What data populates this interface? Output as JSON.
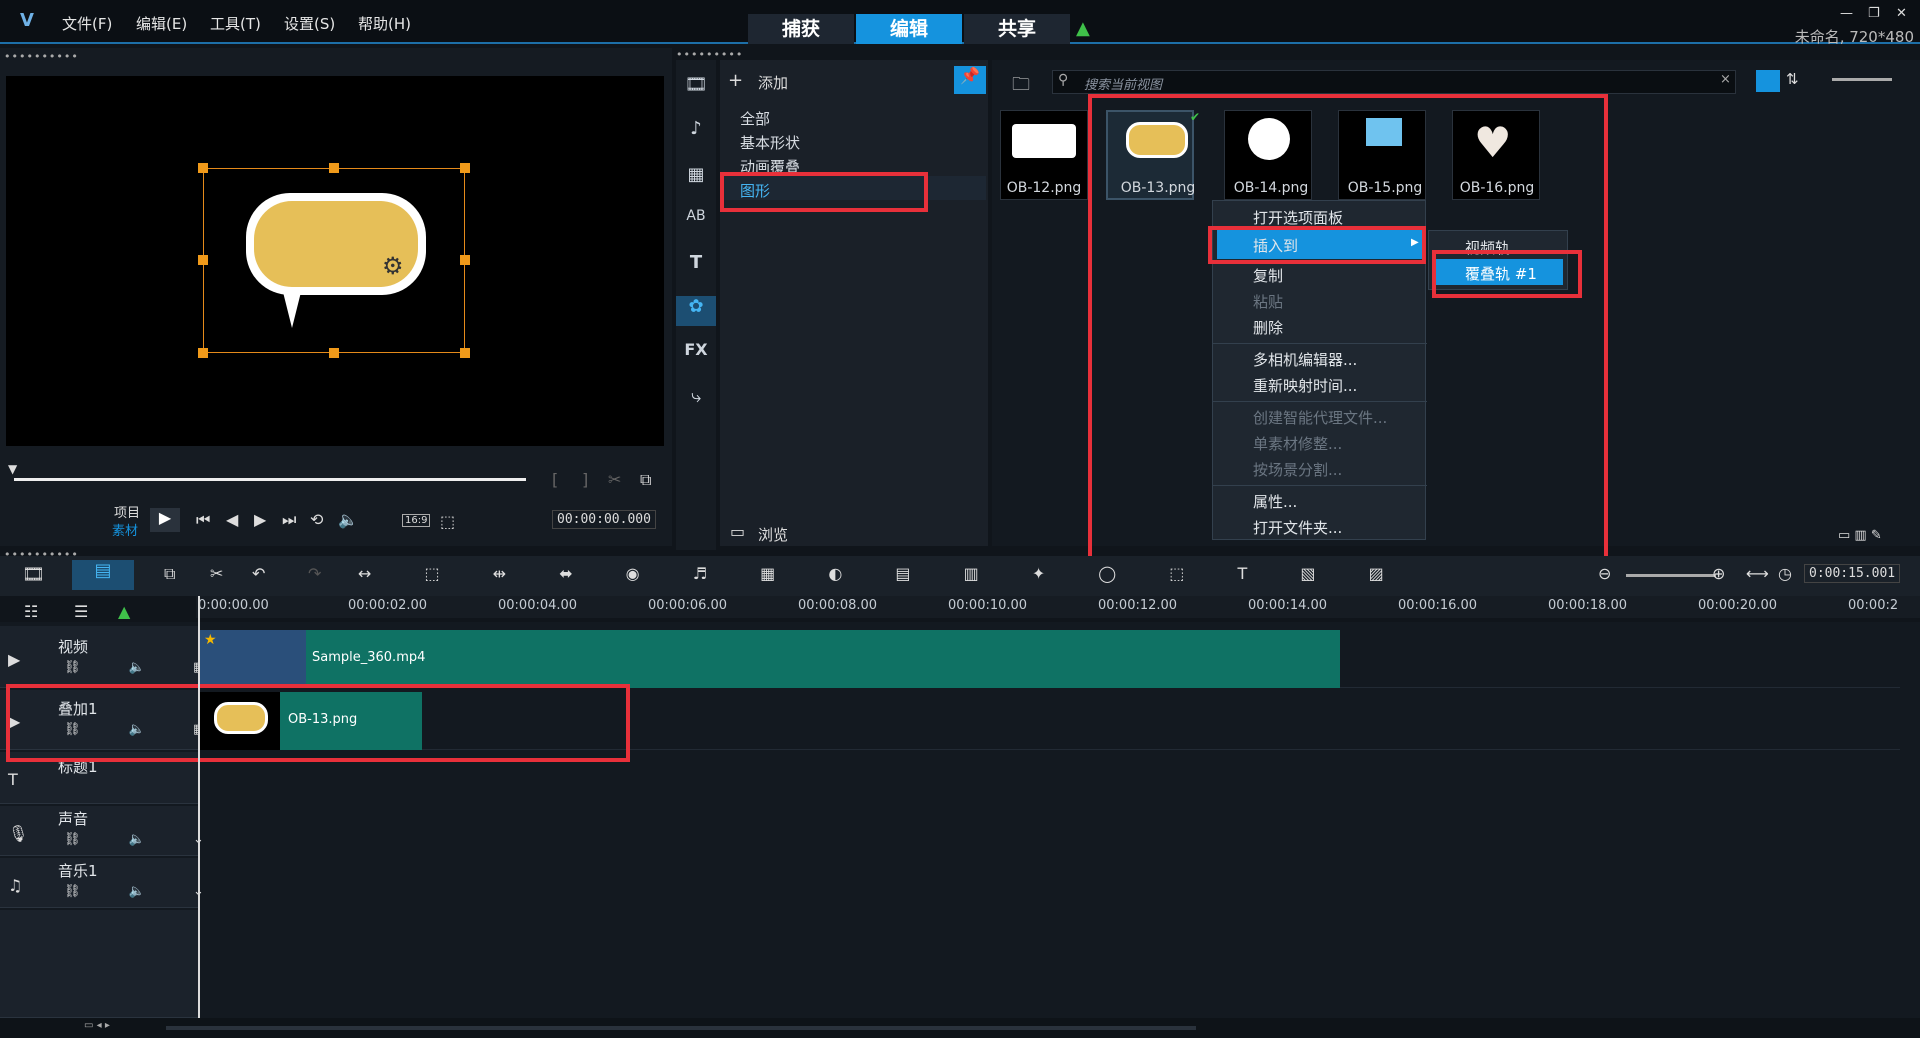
{
  "menubar": {
    "items": [
      "文件(F)",
      "编辑(E)",
      "工具(T)",
      "设置(S)",
      "帮助(H)"
    ],
    "modes": [
      "捕获",
      "编辑",
      "共享"
    ],
    "active_mode": "编辑",
    "project": "未命名, 720*480"
  },
  "preview": {
    "mode_project": "项目",
    "mode_clip": "素材",
    "aspect": "16:9",
    "timecode": "00:00:00.000"
  },
  "library": {
    "add_label": "添加",
    "categories": [
      "全部",
      "基本形状",
      "动画覆叠",
      "图形"
    ],
    "selected_category": "图形",
    "browse_label": "浏览",
    "search_placeholder": "搜索当前视图",
    "thumbs": [
      "OB-12.png",
      "OB-13.png",
      "OB-14.png",
      "OB-15.png",
      "OB-16.png"
    ]
  },
  "context_menu": {
    "items": [
      {
        "label": "打开选项面板",
        "enabled": true
      },
      {
        "label": "插入到",
        "enabled": true,
        "highlight": true
      },
      {
        "label": "复制",
        "enabled": true
      },
      {
        "label": "粘贴",
        "enabled": false
      },
      {
        "label": "删除",
        "enabled": true
      },
      {
        "label": "多相机编辑器...",
        "enabled": true
      },
      {
        "label": "重新映射时间...",
        "enabled": true
      },
      {
        "label": "创建智能代理文件...",
        "enabled": false
      },
      {
        "label": "单素材修整...",
        "enabled": false
      },
      {
        "label": "按场景分割...",
        "enabled": false
      },
      {
        "label": "属性...",
        "enabled": true
      },
      {
        "label": "打开文件夹...",
        "enabled": true
      }
    ],
    "submenu": [
      "视频轨",
      "覆叠轨 #1"
    ]
  },
  "timeline": {
    "duration": "0:00:15.001",
    "ruler": [
      "0:00:00.00",
      "00:00:02.00",
      "00:00:04.00",
      "00:00:06.00",
      "00:00:08.00",
      "00:00:10.00",
      "00:00:12.00",
      "00:00:14.00",
      "00:00:16.00",
      "00:00:18.00",
      "00:00:20.00",
      "00:00:2"
    ],
    "tracks": [
      "视频",
      "叠加1",
      "标题1",
      "声音",
      "音乐1"
    ],
    "clips": {
      "video": "Sample_360.mp4",
      "overlay": "OB-13.png"
    }
  },
  "colors": {
    "accent": "#1593de",
    "highlight_box": "#e8303a",
    "clip": "#0f7264"
  }
}
